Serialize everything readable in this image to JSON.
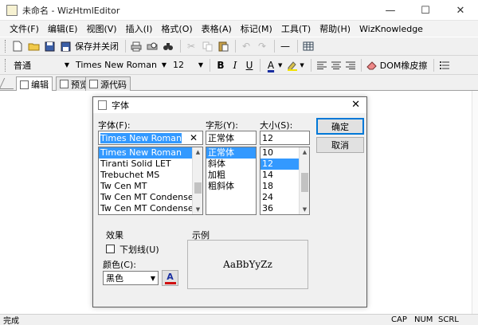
{
  "window": {
    "title": "未命名 - WizHtmlEditor",
    "minimize": "—",
    "maximize": "☐",
    "close": "✕"
  },
  "menu": [
    "文件(F)",
    "编辑(E)",
    "视图(V)",
    "插入(I)",
    "格式(O)",
    "表格(A)",
    "标记(M)",
    "工具(T)",
    "帮助(H)",
    "WizKnowledge"
  ],
  "toolbar": {
    "save_close_label": "保存并关闭",
    "dom_label": "DOM橡皮擦"
  },
  "format": {
    "style": "普通",
    "font": "Times New Roman",
    "size": "12",
    "bold": "B",
    "italic": "I",
    "underline": "U",
    "font_color": "A"
  },
  "tabs": [
    "编辑",
    "预览",
    "源代码"
  ],
  "status": {
    "left": "完成",
    "cap": "CAP",
    "num": "NUM",
    "scrl": "SCRL"
  },
  "dialog": {
    "title": "字体",
    "close": "✕",
    "font_label": "字体(F):",
    "font_value": "Times New Roman",
    "font_list": [
      "Times New Roman",
      "Tiranti Solid LET",
      "Trebuchet MS",
      "Tw Cen MT",
      "Tw Cen MT Condensed",
      "Tw Cen MT Condensed"
    ],
    "style_label": "字形(Y):",
    "style_value": "正常体",
    "style_list": [
      "正常体",
      "斜体",
      "加粗",
      "粗斜体"
    ],
    "size_label": "大小(S):",
    "size_value": "12",
    "size_list": [
      "10",
      "12",
      "14",
      "18",
      "24",
      "36"
    ],
    "ok": "确定",
    "cancel": "取消",
    "effects_label": "效果",
    "underline_label": "下划线(U)",
    "color_label": "颜色(C):",
    "color_value": "黑色",
    "sample_label": "示例",
    "sample_text": "AaBbYyZz"
  }
}
